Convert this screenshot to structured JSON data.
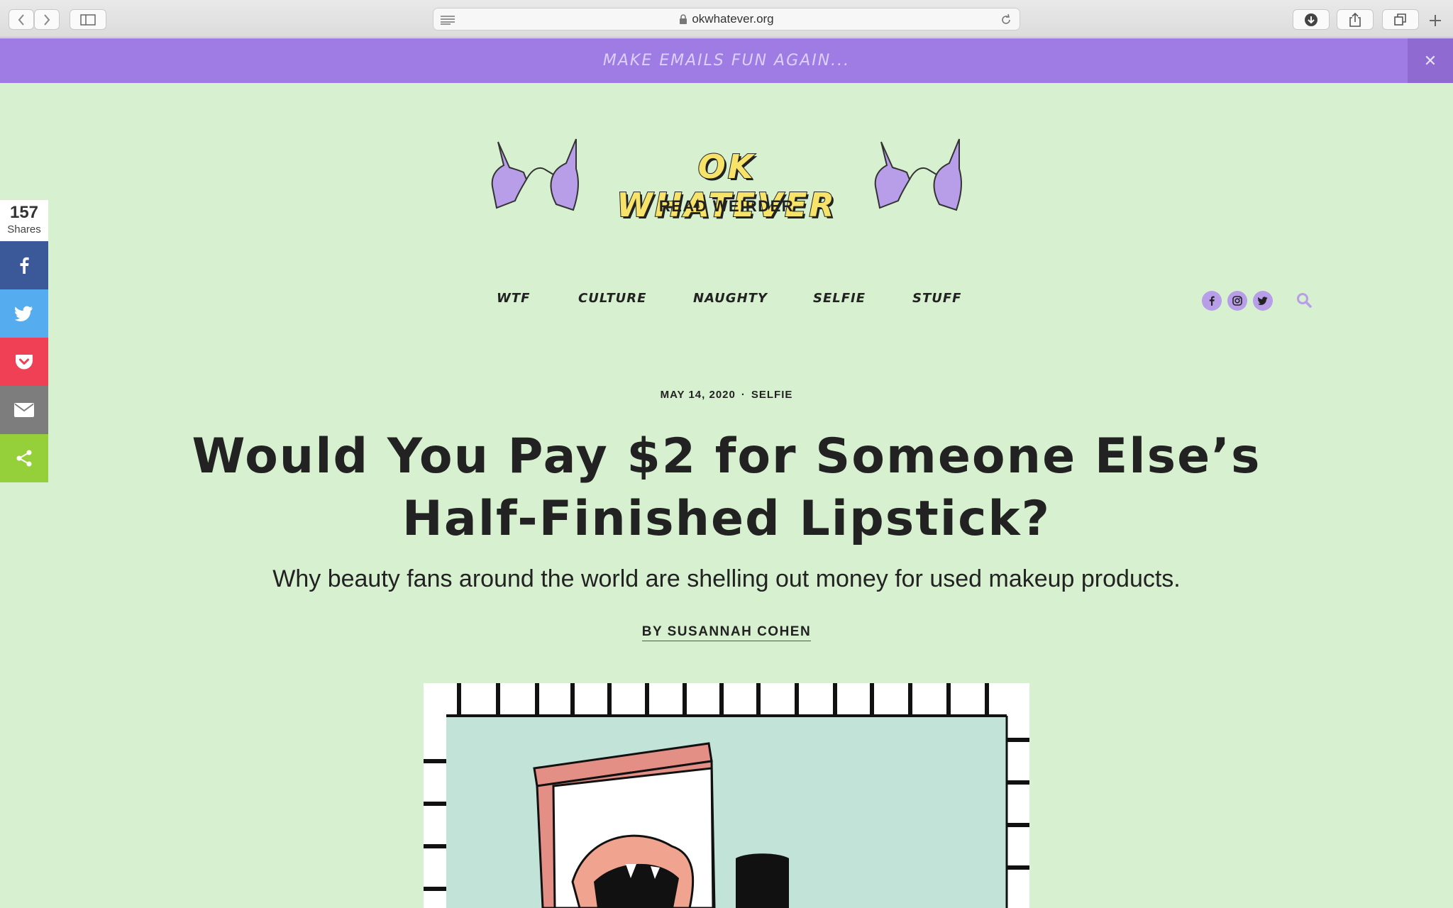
{
  "browser": {
    "url": "okwhatever.org"
  },
  "banner": {
    "text": "MAKE EMAILS FUN AGAIN...",
    "close_label": "✕"
  },
  "share": {
    "count": "157",
    "label": "Shares",
    "buttons": [
      "facebook",
      "twitter",
      "pocket",
      "email",
      "share"
    ],
    "colors": {
      "facebook": "#3b5998",
      "twitter": "#55acee",
      "pocket": "#ef4056",
      "email": "#7d7d7d",
      "share": "#95d03a"
    }
  },
  "logo": {
    "title": "OK WHATEVER",
    "tagline": "READ WEIRDER"
  },
  "nav": {
    "items": [
      "WTF",
      "CULTURE",
      "NAUGHTY",
      "SELFIE",
      "STUFF"
    ],
    "social_icons": [
      "facebook-icon",
      "instagram-icon",
      "twitter-icon"
    ],
    "search_icon": "search-icon"
  },
  "article": {
    "date": "MAY 14, 2020",
    "separator": "·",
    "category": "SELFIE",
    "headline": "Would You Pay $2 for Someone Else’s Half-Finished Lipstick?",
    "dek": "Why beauty fans around the world are shelling out money for used makeup products.",
    "byline": "BY SUSANNAH COHEN"
  },
  "theme": {
    "background": "#d7f0d0",
    "banner": "#9f7ce3",
    "accent_purple": "#b89de8",
    "logo_yellow": "#f7e36a"
  }
}
